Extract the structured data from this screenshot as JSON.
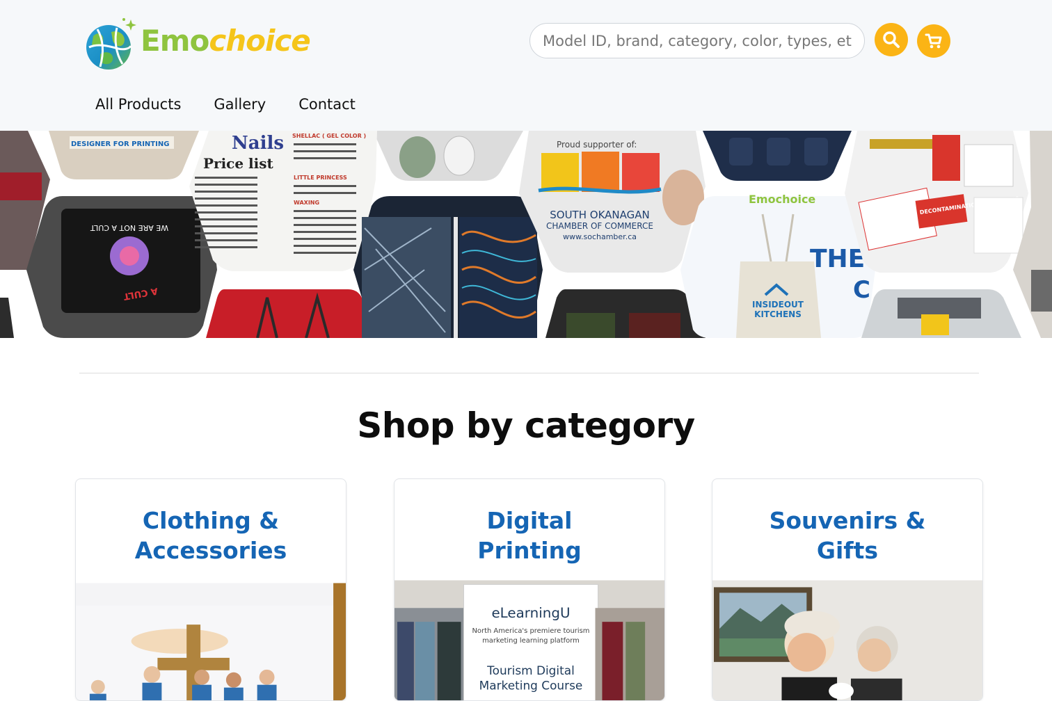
{
  "brand": {
    "name_part1": "Emo",
    "name_part2": "choice"
  },
  "search": {
    "placeholder": "Model ID, brand, category, color, types, etc..."
  },
  "nav": {
    "items": [
      {
        "label": "All Products"
      },
      {
        "label": "Gallery"
      },
      {
        "label": "Contact"
      }
    ]
  },
  "section": {
    "title": "Shop by category"
  },
  "categories": [
    {
      "title": "Clothing & Accessories"
    },
    {
      "title": "Digital Printing"
    },
    {
      "title": "Souvenirs & Gifts"
    }
  ],
  "banner": {
    "nails_sign_title": "Nails",
    "nails_sign_subtitle": "Price list",
    "nails_col2_heading": "SHELLAC ( GEL COLOR )",
    "nails_col2_heading2": "LITTLE PRINCESS",
    "nails_col2_heading3": "WAXING",
    "chamber_line1": "Proud supporter of:",
    "chamber_line2": "SOUTH OKANAGAN",
    "chamber_line3": "CHAMBER OF COMMERCE",
    "chamber_line4": "www.sochamber.ca",
    "shirt_text": "WE ARE NOT A CULT",
    "bag_text1": "INSIDEOUT",
    "bag_text2": "KITCHENS",
    "bag_brand": "Emochoice",
    "sign_text": "DECONTAMINATION IN PROCESS"
  },
  "card_images": {
    "card2_banner_brand": "eLearningU",
    "card2_banner_line1": "North America's premiere tourism",
    "card2_banner_line2": "marketing learning platform",
    "card2_banner_line3": "Tourism Digital",
    "card2_banner_line4": "Marketing Course"
  },
  "colors": {
    "accent": "#fbb415",
    "link": "#1565b4",
    "header_bg": "#f6f8fa",
    "logo_green": "#8fc43f",
    "logo_yellow": "#f5c51a"
  },
  "icons": {
    "search": "search-icon",
    "cart": "cart-icon"
  }
}
